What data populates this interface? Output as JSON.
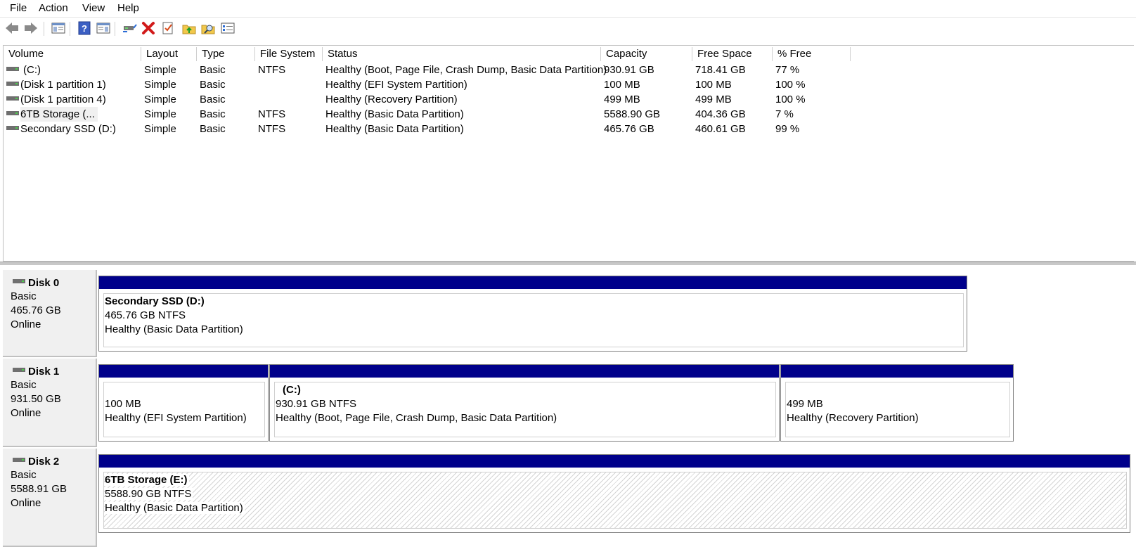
{
  "menu": [
    "File",
    "Action",
    "View",
    "Help"
  ],
  "toolbar_icons": [
    "back-arrow-icon",
    "forward-arrow-icon",
    "show-hide-console-tree-icon",
    "help-icon",
    "properties-pane-icon",
    "connect-drive-icon",
    "delete-icon",
    "checklist-icon",
    "folder-up-icon",
    "folder-search-icon",
    "list-settings-icon"
  ],
  "columns": [
    "Volume",
    "Layout",
    "Type",
    "File System",
    "Status",
    "Capacity",
    "Free Space",
    "% Free"
  ],
  "volumes": [
    {
      "volume": "(C:)",
      "layout": "Simple",
      "type": "Basic",
      "fs": "NTFS",
      "status": "Healthy (Boot, Page File, Crash Dump, Basic Data Partition)",
      "capacity": "930.91 GB",
      "free": "718.41 GB",
      "pct": "77 %"
    },
    {
      "volume": "(Disk 1 partition 1)",
      "layout": "Simple",
      "type": "Basic",
      "fs": "",
      "status": "Healthy (EFI System Partition)",
      "capacity": "100 MB",
      "free": "100 MB",
      "pct": "100 %"
    },
    {
      "volume": "(Disk 1 partition 4)",
      "layout": "Simple",
      "type": "Basic",
      "fs": "",
      "status": "Healthy (Recovery Partition)",
      "capacity": "499 MB",
      "free": "499 MB",
      "pct": "100 %"
    },
    {
      "volume": "6TB Storage (...",
      "layout": "Simple",
      "type": "Basic",
      "fs": "NTFS",
      "status": "Healthy (Basic Data Partition)",
      "capacity": "5588.90 GB",
      "free": "404.36 GB",
      "pct": "7 %"
    },
    {
      "volume": "Secondary SSD (D:)",
      "layout": "Simple",
      "type": "Basic",
      "fs": "NTFS",
      "status": "Healthy (Basic Data Partition)",
      "capacity": "465.76 GB",
      "free": "460.61 GB",
      "pct": "99 %"
    }
  ],
  "disks": [
    {
      "name": "Disk 0",
      "type": "Basic",
      "size": "465.76 GB",
      "state": "Online",
      "partitions": [
        {
          "title": "Secondary SSD  (D:)",
          "size": "465.76 GB NTFS",
          "status": "Healthy (Basic Data Partition)"
        }
      ]
    },
    {
      "name": "Disk 1",
      "type": "Basic",
      "size": "931.50 GB",
      "state": "Online",
      "partitions": [
        {
          "title": "",
          "size": "100 MB",
          "status": "Healthy (EFI System Partition)"
        },
        {
          "title": "(C:)",
          "size": "930.91 GB NTFS",
          "status": "Healthy (Boot, Page File, Crash Dump, Basic Data Partition)"
        },
        {
          "title": "",
          "size": "499 MB",
          "status": "Healthy (Recovery Partition)"
        }
      ]
    },
    {
      "name": "Disk 2",
      "type": "Basic",
      "size": "5588.91 GB",
      "state": "Online",
      "partitions": [
        {
          "title": "6TB Storage  (E:)",
          "size": "5588.90 GB NTFS",
          "status": "Healthy (Basic Data Partition)"
        }
      ]
    }
  ],
  "colors": {
    "partition_bar": "#00008b",
    "label_bg": "#f0f0f0"
  }
}
